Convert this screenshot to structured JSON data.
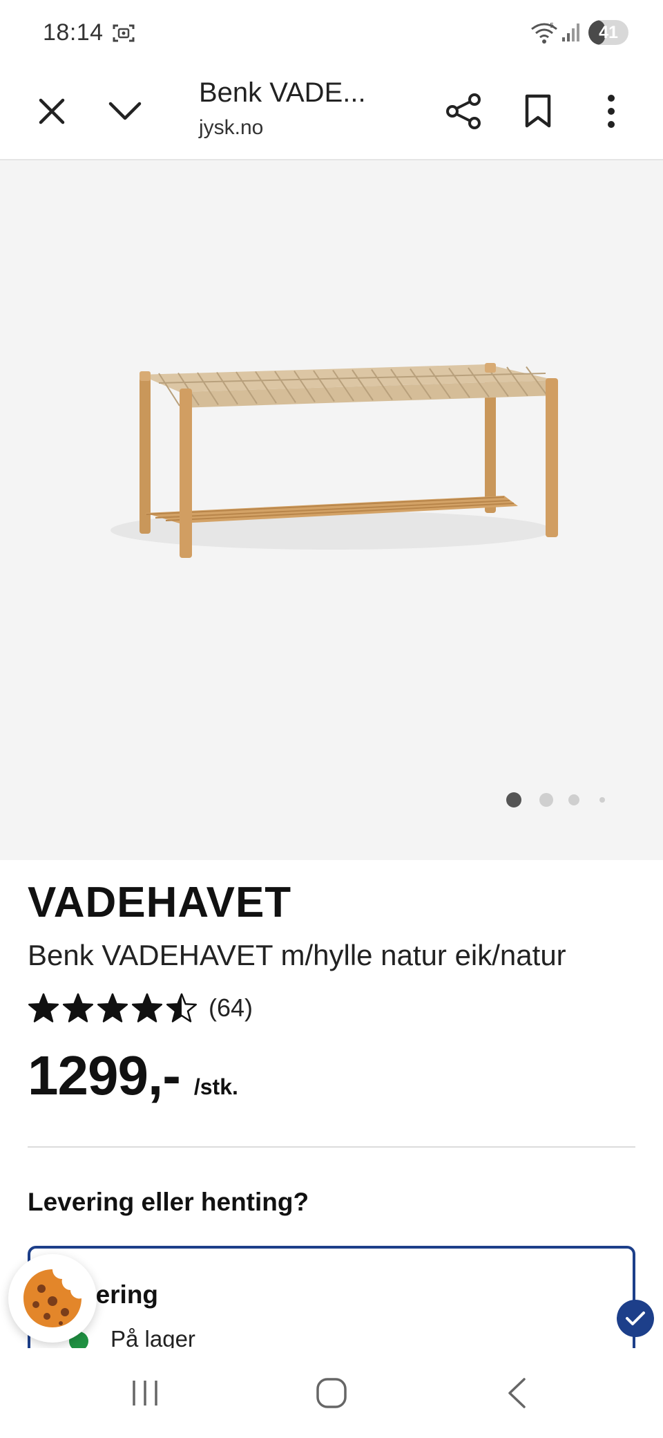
{
  "status_bar": {
    "time": "18:14",
    "battery_level": "41",
    "icons": [
      "screenshot-icon",
      "wifi-icon",
      "signal-icon",
      "battery-icon"
    ]
  },
  "toolbar": {
    "title": "Benk VADE...",
    "domain": "jysk.no",
    "icons": [
      "close-icon",
      "chevron-down-icon",
      "share-icon",
      "bookmark-icon",
      "more-vert-icon"
    ]
  },
  "gallery": {
    "image": "bench-image",
    "page_count": 4,
    "active_index": 0
  },
  "product": {
    "brand": "VADEHAVET",
    "name": "Benk VADEHAVET m/hylle natur eik/natur",
    "rating_value": 4.5,
    "rating_count": "(64)",
    "price": "1299,-",
    "unit": "/stk."
  },
  "delivery": {
    "heading": "Levering eller henting?",
    "option_label": "Levering",
    "option_label_visible": "vering",
    "stock_text": "På lager",
    "colors": {
      "accent": "#1d3f8a",
      "in_stock": "#1f9142"
    }
  },
  "cookie": {
    "icon": "cookie-icon"
  },
  "navbar": {
    "icons": [
      "recent-apps-icon",
      "home-icon",
      "back-icon"
    ]
  }
}
